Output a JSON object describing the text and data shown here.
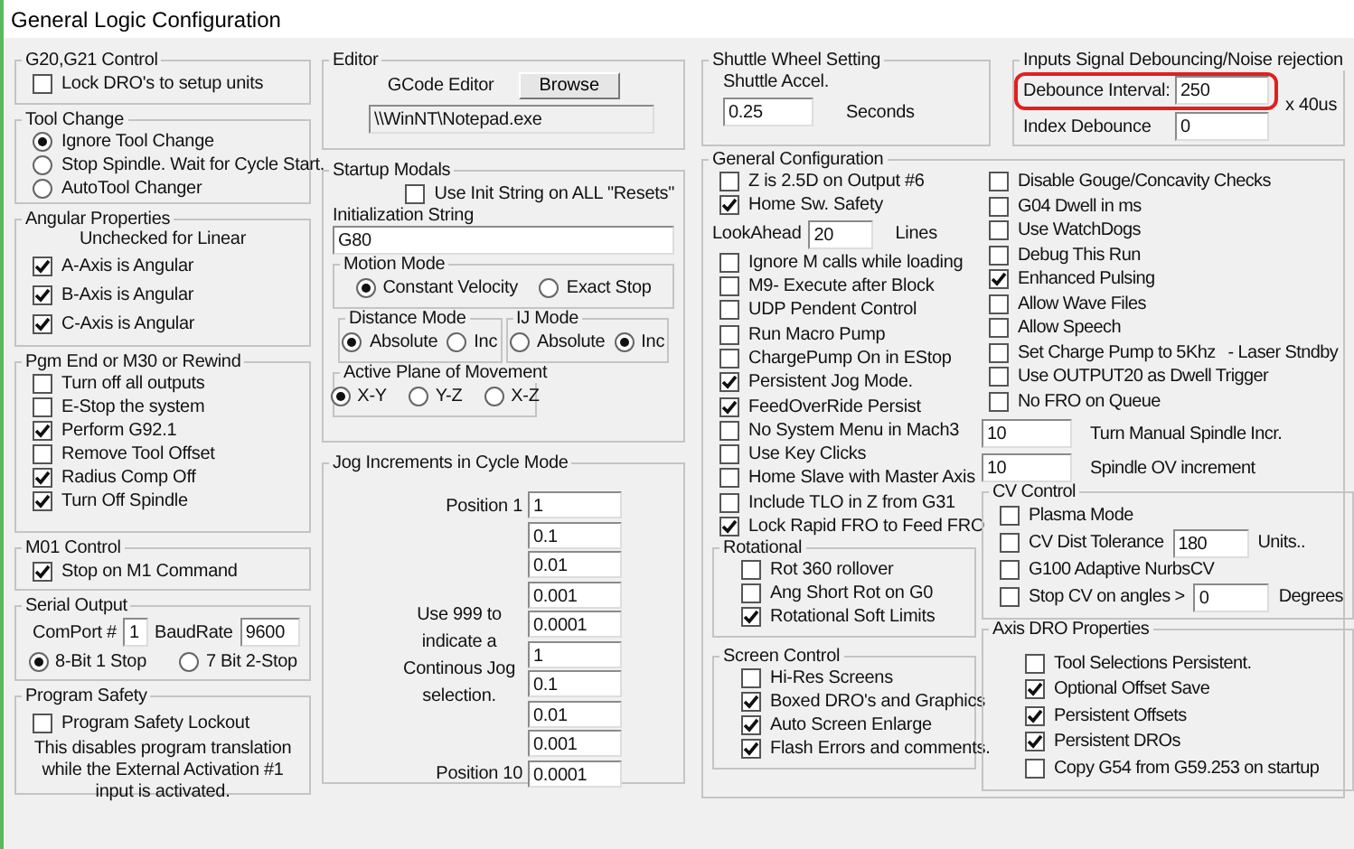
{
  "window": {
    "title": "General Logic Configuration"
  },
  "left_groups": [
    {
      "title": "G20,G21 Control",
      "items": [
        {
          "kind": "checkbox",
          "label": "Lock DRO's to setup units",
          "checked": false
        }
      ]
    },
    {
      "title": "Tool Change",
      "items": [
        {
          "kind": "radio",
          "label": "Ignore Tool Change",
          "selected": true
        },
        {
          "kind": "radio",
          "label": "Stop Spindle. Wait for Cycle Start.",
          "selected": false
        },
        {
          "kind": "radio",
          "label": "AutoTool Changer",
          "selected": false
        }
      ]
    },
    {
      "title": "Angular Properties",
      "items": [
        {
          "kind": "note",
          "text": "Unchecked for Linear"
        },
        {
          "kind": "checkbox",
          "label": "A-Axis is Angular",
          "checked": true
        },
        {
          "kind": "checkbox",
          "label": "B-Axis is Angular",
          "checked": true
        },
        {
          "kind": "checkbox",
          "label": "C-Axis is Angular",
          "checked": true
        }
      ]
    },
    {
      "title": "Pgm End or M30 or Rewind",
      "items": [
        {
          "kind": "checkbox",
          "label": "Turn off all outputs",
          "checked": false
        },
        {
          "kind": "checkbox",
          "label": "E-Stop the system",
          "checked": false
        },
        {
          "kind": "checkbox",
          "label": "Perform G92.1",
          "checked": true
        },
        {
          "kind": "checkbox",
          "label": "Remove Tool Offset",
          "checked": false
        },
        {
          "kind": "checkbox",
          "label": "Radius Comp Off",
          "checked": true
        },
        {
          "kind": "checkbox",
          "label": "Turn Off Spindle",
          "checked": true
        }
      ]
    },
    {
      "title": "M01 Control",
      "items": [
        {
          "kind": "checkbox",
          "label": "Stop on M1 Command",
          "checked": true
        }
      ]
    },
    {
      "title": "Serial Output",
      "items": [
        {
          "kind": "fields",
          "fields": [
            {
              "label": "ComPort #",
              "value": "1"
            },
            {
              "label": "BaudRate",
              "value": "9600"
            }
          ]
        },
        {
          "kind": "radios",
          "options": [
            {
              "label": "8-Bit 1 Stop",
              "selected": true
            },
            {
              "label": "7 Bit 2-Stop",
              "selected": false
            }
          ]
        }
      ]
    },
    {
      "title": "Program Safety",
      "items": [
        {
          "kind": "checkbox",
          "label": "Program Safety Lockout",
          "checked": false
        },
        {
          "kind": "note",
          "text": "This disables program translation while the External Activation #1 input is activated."
        }
      ]
    }
  ],
  "editor": {
    "title": "Editor",
    "label": "GCode Editor",
    "button": "Browse",
    "path": "\\\\WinNT\\Notepad.exe"
  },
  "startup_modals": {
    "title": "Startup Modals",
    "init_all": {
      "label": "Use Init String on ALL  \"Resets\"",
      "checked": false
    },
    "init_label": "Initialization String",
    "init_value": "G80",
    "radio_groups": [
      {
        "title": "Motion Mode",
        "options": [
          {
            "label": "Constant Velocity",
            "selected": true
          },
          {
            "label": "Exact Stop",
            "selected": false
          }
        ]
      },
      {
        "title": "Distance Mode",
        "options": [
          {
            "label": "Absolute",
            "selected": true
          },
          {
            "label": "Inc",
            "selected": false
          }
        ]
      },
      {
        "title": "IJ Mode",
        "options": [
          {
            "label": "Absolute",
            "selected": false
          },
          {
            "label": "Inc",
            "selected": true
          }
        ]
      },
      {
        "title": "Active Plane of Movement",
        "options": [
          {
            "label": "X-Y",
            "selected": true
          },
          {
            "label": "Y-Z",
            "selected": false
          },
          {
            "label": "X-Z",
            "selected": false
          }
        ]
      }
    ]
  },
  "jog": {
    "title": "Jog Increments in Cycle Mode",
    "first_label": "Position 1",
    "note": "Use 999 to indicate a Continous Jog selection.",
    "last_label": "Position 10",
    "values": [
      "1",
      "0.1",
      "0.01",
      "0.001",
      "0.0001",
      "1",
      "0.1",
      "0.01",
      "0.001",
      "0.0001"
    ]
  },
  "shuttle": {
    "title": "Shuttle Wheel Setting",
    "label": "Shuttle Accel.",
    "value": "0.25",
    "suffix": "Seconds"
  },
  "debounce": {
    "title": "Inputs Signal Debouncing/Noise rejection",
    "rows": [
      {
        "label": "Debounce Interval:",
        "value": "250",
        "highlighted": true
      },
      {
        "label": "Index Debounce",
        "value": "0",
        "highlighted": false
      }
    ],
    "suffix": "x 40us"
  },
  "general": {
    "title": "General Configuration",
    "left_items": [
      {
        "kind": "checkbox",
        "label": "Z is 2.5D on Output #6",
        "checked": false
      },
      {
        "kind": "checkbox",
        "label": "Home Sw. Safety",
        "checked": true
      },
      {
        "kind": "field",
        "label": "LookAhead",
        "value": "20",
        "suffix": "Lines"
      },
      {
        "kind": "checkbox",
        "label": "Ignore M calls while loading",
        "checked": false
      },
      {
        "kind": "checkbox",
        "label": "M9- Execute after Block",
        "checked": false
      },
      {
        "kind": "checkbox",
        "label": "UDP Pendent Control",
        "checked": false
      },
      {
        "kind": "checkbox",
        "label": "Run Macro Pump",
        "checked": false
      },
      {
        "kind": "checkbox",
        "label": "ChargePump On in EStop",
        "checked": false
      },
      {
        "kind": "checkbox",
        "label": "Persistent Jog Mode.",
        "checked": true
      },
      {
        "kind": "checkbox",
        "label": "FeedOverRide Persist",
        "checked": true
      },
      {
        "kind": "checkbox",
        "label": "No System Menu in Mach3",
        "checked": false
      },
      {
        "kind": "checkbox",
        "label": "Use Key Clicks",
        "checked": false
      },
      {
        "kind": "checkbox",
        "label": "Home Slave with Master Axis",
        "checked": false
      },
      {
        "kind": "checkbox",
        "label": "Include TLO in Z from G31",
        "checked": false
      },
      {
        "kind": "checkbox",
        "label": "Lock Rapid FRO to Feed FRO",
        "checked": true
      }
    ],
    "left_groups": [
      {
        "title": "Rotational",
        "items": [
          {
            "kind": "checkbox",
            "label": "Rot 360 rollover",
            "checked": false
          },
          {
            "kind": "checkbox",
            "label": "Ang Short Rot on G0",
            "checked": false
          },
          {
            "kind": "checkbox",
            "label": "Rotational Soft Limits",
            "checked": true
          }
        ]
      },
      {
        "title": "Screen Control",
        "items": [
          {
            "kind": "checkbox",
            "label": "Hi-Res Screens",
            "checked": false
          },
          {
            "kind": "checkbox",
            "label": "Boxed DRO's and Graphics",
            "checked": true
          },
          {
            "kind": "checkbox",
            "label": "Auto Screen Enlarge",
            "checked": true
          },
          {
            "kind": "checkbox",
            "label": "Flash Errors and comments.",
            "checked": true
          }
        ]
      }
    ],
    "right_items": [
      {
        "kind": "checkbox",
        "label": "Disable Gouge/Concavity Checks",
        "checked": false
      },
      {
        "kind": "checkbox",
        "label": "G04 Dwell in ms",
        "checked": false
      },
      {
        "kind": "checkbox",
        "label": "Use WatchDogs",
        "checked": false
      },
      {
        "kind": "checkbox",
        "label": "Debug This Run",
        "checked": false
      },
      {
        "kind": "checkbox",
        "label": "Enhanced Pulsing",
        "checked": true
      },
      {
        "kind": "checkbox",
        "label": "Allow Wave Files",
        "checked": false
      },
      {
        "kind": "checkbox",
        "label": "Allow Speech",
        "checked": false
      },
      {
        "kind": "checkbox",
        "label": "Set Charge Pump to 5Khz",
        "note": "- Laser Stndby",
        "checked": false
      },
      {
        "kind": "checkbox",
        "label": "Use OUTPUT20 as Dwell Trigger",
        "checked": false
      },
      {
        "kind": "checkbox",
        "label": "No FRO on Queue",
        "checked": false
      },
      {
        "kind": "value_field",
        "value": "10",
        "suffix": "Turn Manual Spindle Incr."
      },
      {
        "kind": "value_field",
        "value": "10",
        "suffix": "Spindle OV increment"
      }
    ],
    "right_groups": [
      {
        "title": "CV Control",
        "items": [
          {
            "kind": "checkbox",
            "label": "Plasma Mode",
            "checked": false
          },
          {
            "kind": "checkbox",
            "label": "CV Dist Tolerance",
            "checked": false,
            "value": "180",
            "suffix": "Units.."
          },
          {
            "kind": "checkbox",
            "label": "G100 Adaptive NurbsCV",
            "checked": false
          },
          {
            "kind": "checkbox",
            "label": "Stop CV on angles >",
            "checked": false,
            "value": "0",
            "suffix": "Degrees"
          }
        ]
      },
      {
        "title": "Axis DRO Properties",
        "items": [
          {
            "kind": "checkbox",
            "label": "Tool Selections Persistent.",
            "checked": false
          },
          {
            "kind": "checkbox",
            "label": "Optional Offset Save",
            "checked": true
          },
          {
            "kind": "checkbox",
            "label": "Persistent Offsets",
            "checked": true
          },
          {
            "kind": "checkbox",
            "label": "Persistent DROs",
            "checked": true
          },
          {
            "kind": "checkbox",
            "label": "Copy G54 from G59.253 on startup",
            "checked": false
          }
        ]
      }
    ]
  }
}
